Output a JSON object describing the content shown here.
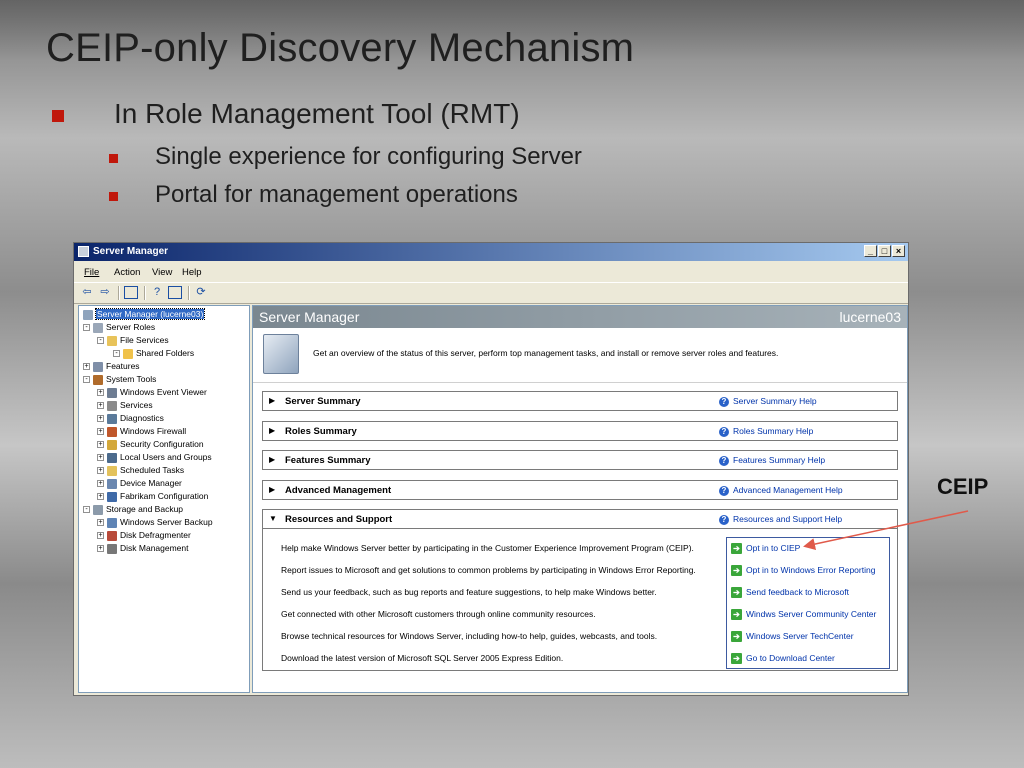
{
  "slide": {
    "title": "CEIP-only Discovery Mechanism",
    "bullet1": "In Role Management Tool (RMT)",
    "sub1": "Single experience for configuring Server",
    "sub2": "Portal for management operations",
    "callout": "CEIP"
  },
  "window": {
    "title": "Server Manager",
    "buttons": [
      "_",
      "□",
      "×"
    ],
    "menu": [
      "File",
      "Action",
      "View",
      "Help"
    ]
  },
  "tree": [
    {
      "label": "Server Manager (lucerne03)",
      "selected": true
    },
    {
      "label": "Server Roles"
    },
    {
      "label": "File Services"
    },
    {
      "label": "Shared Folders"
    },
    {
      "label": "Features"
    },
    {
      "label": "System Tools"
    },
    {
      "label": "Windows Event Viewer"
    },
    {
      "label": "Services"
    },
    {
      "label": "Diagnostics"
    },
    {
      "label": "Windows Firewall"
    },
    {
      "label": "Security Configuration"
    },
    {
      "label": "Local Users and Groups"
    },
    {
      "label": "Scheduled Tasks"
    },
    {
      "label": "Device Manager"
    },
    {
      "label": "Fabrikam Configuration"
    },
    {
      "label": "Storage and Backup"
    },
    {
      "label": "Windows Server Backup"
    },
    {
      "label": "Disk Defragmenter"
    },
    {
      "label": "Disk Management"
    }
  ],
  "main": {
    "header_left": "Server Manager",
    "header_right": "lucerne03",
    "overview": "Get an overview of the status of this server, perform top management tasks, and install or remove server roles and features.",
    "sections": [
      {
        "label": "Server Summary",
        "help": "Server Summary Help",
        "expanded": false
      },
      {
        "label": "Roles Summary",
        "help": "Roles Summary Help",
        "expanded": false
      },
      {
        "label": "Features Summary",
        "help": "Features Summary Help",
        "expanded": false
      },
      {
        "label": "Advanced Management",
        "help": "Advanced Management Help",
        "expanded": false
      },
      {
        "label": "Resources and Support",
        "help": "Resources and Support Help",
        "expanded": true
      }
    ],
    "resources": [
      {
        "text": "Help make Windows Server better by participating in the Customer Experience Improvement Program (CEIP).",
        "link": "Opt in to CIEP"
      },
      {
        "text": "Report issues to Microsoft and get solutions to common problems by participating in Windows Error Reporting.",
        "link": "Opt in to Windows Error Reporting"
      },
      {
        "text": "Send us your feedback, such as bug reports and feature suggestions, to help make Windows better.",
        "link": "Send feedback to Microsoft"
      },
      {
        "text": "Get connected with other Microsoft customers through online community resources.",
        "link": "Windws Server Community Center"
      },
      {
        "text": "Browse technical resources for Windows Server, including how-to help, guides, webcasts, and tools.",
        "link": "Windows Server TechCenter"
      },
      {
        "text": "Download the latest version of Microsoft SQL Server 2005 Express Edition.",
        "link": "Go to Download Center"
      }
    ]
  },
  "colors": {
    "bullet": "#c0170b",
    "link": "#0033aa",
    "titlebar": "#0a246a",
    "callout_arrow": "#e05a4a"
  }
}
